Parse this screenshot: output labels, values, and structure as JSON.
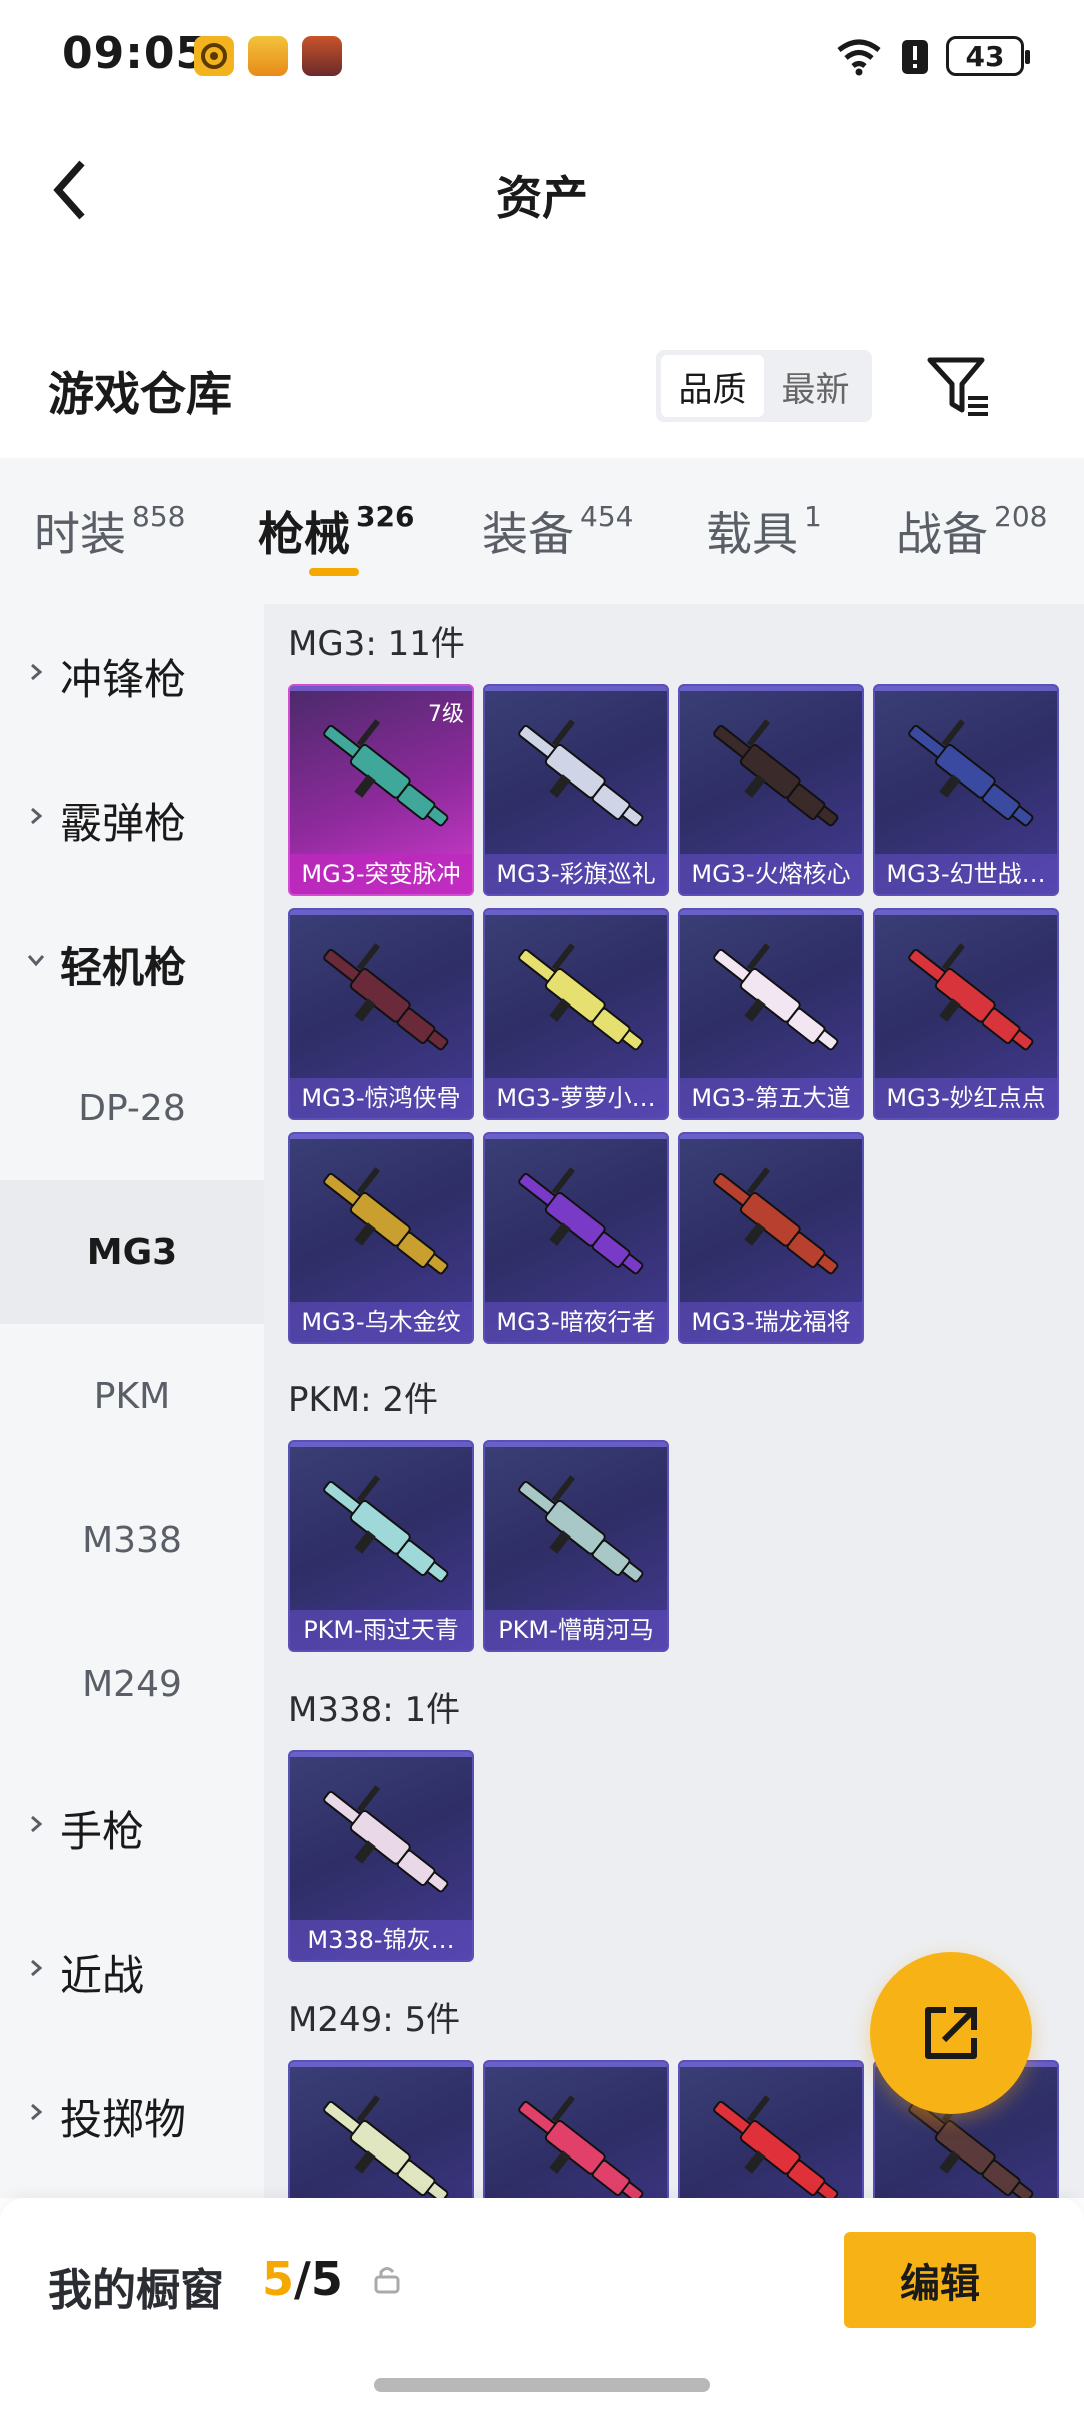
{
  "status_bar": {
    "time": "09:05",
    "battery": "43"
  },
  "header": {
    "title": "资产"
  },
  "warehouse": {
    "title": "游戏仓库",
    "sort_options": [
      "品质",
      "最新"
    ],
    "sort_selected": "品质"
  },
  "tabs": [
    {
      "label": "时装",
      "count": "858"
    },
    {
      "label": "枪械",
      "count": "326",
      "active": true
    },
    {
      "label": "装备",
      "count": "454"
    },
    {
      "label": "载具",
      "count": "1"
    },
    {
      "label": "战备",
      "count": "208"
    }
  ],
  "sidebar": {
    "items": [
      {
        "label": "冲锋枪",
        "type": "category"
      },
      {
        "label": "霰弹枪",
        "type": "category"
      },
      {
        "label": "轻机枪",
        "type": "category",
        "open": true
      },
      {
        "label": "DP-28",
        "type": "sub"
      },
      {
        "label": "MG3",
        "type": "sub",
        "selected": true
      },
      {
        "label": "PKM",
        "type": "sub"
      },
      {
        "label": "M338",
        "type": "sub"
      },
      {
        "label": "M249",
        "type": "sub"
      },
      {
        "label": "手枪",
        "type": "category"
      },
      {
        "label": "近战",
        "type": "category"
      },
      {
        "label": "投掷物",
        "type": "category"
      }
    ]
  },
  "groups": [
    {
      "title": "MG3: 11件",
      "items": [
        {
          "name": "MG3-突变脉冲",
          "level": "7级",
          "rare": true,
          "color": "#3fa89a"
        },
        {
          "name": "MG3-彩旗巡礼",
          "color": "#cfd4e6"
        },
        {
          "name": "MG3-火熔核心",
          "color": "#3a2a2a"
        },
        {
          "name": "MG3-幻世战…",
          "color": "#3a4aa0"
        },
        {
          "name": "MG3-惊鸿侠骨",
          "color": "#6a2a3a"
        },
        {
          "name": "MG3-萝萝小…",
          "color": "#e6e070"
        },
        {
          "name": "MG3-第五大道",
          "color": "#f2e6f2"
        },
        {
          "name": "MG3-妙红点点",
          "color": "#d8343c"
        },
        {
          "name": "MG3-乌木金纹",
          "color": "#c9a030"
        },
        {
          "name": "MG3-暗夜行者",
          "color": "#7a3ac8"
        },
        {
          "name": "MG3-瑞龙福将",
          "color": "#b8402e"
        }
      ]
    },
    {
      "title": "PKM: 2件",
      "items": [
        {
          "name": "PKM-雨过天青",
          "color": "#9ed8d8"
        },
        {
          "name": "PKM-懵萌河马",
          "color": "#a8c8c8"
        }
      ]
    },
    {
      "title": "M338: 1件",
      "items": [
        {
          "name": "M338-锦灰…",
          "color": "#e8d8e8"
        }
      ]
    },
    {
      "title": "M249: 5件",
      "items": [
        {
          "name": "",
          "color": "#e0e6c0"
        },
        {
          "name": "",
          "color": "#e0406a"
        },
        {
          "name": "",
          "color": "#e0303a"
        },
        {
          "name": "",
          "color": "#5a3a3a"
        }
      ]
    }
  ],
  "showcase": {
    "label": "我的橱窗",
    "used": "5",
    "total": "/5",
    "edit_label": "编辑"
  },
  "colors": {
    "accent": "#f5a800",
    "card_rare": "#d23bd0",
    "card_base": "#3a3f76"
  }
}
